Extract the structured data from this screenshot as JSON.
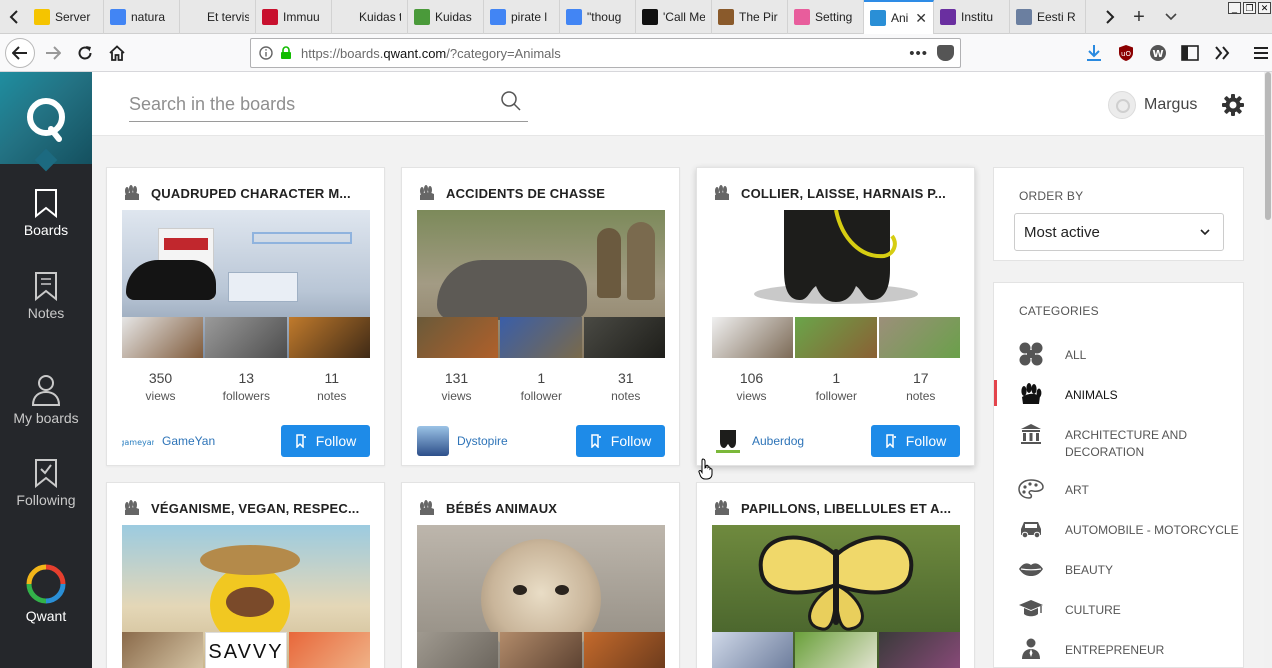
{
  "browser": {
    "tabs": [
      {
        "title": "Server",
        "favicon": "warning-icon",
        "color": "#f5c400"
      },
      {
        "title": "natura",
        "favicon": "google-icon",
        "color": "#4285f4"
      },
      {
        "title": "Et tervist jä",
        "favicon": "none",
        "color": "#e8e8e8"
      },
      {
        "title": "Immuu",
        "favicon": "news-icon",
        "color": "#c8102e"
      },
      {
        "title": "Kuidas tuge",
        "favicon": "none",
        "color": "#e8e8e8"
      },
      {
        "title": "Kuidas",
        "favicon": "leaf-icon",
        "color": "#4a9a3a"
      },
      {
        "title": "pirate l",
        "favicon": "google-icon",
        "color": "#4285f4"
      },
      {
        "title": "\"thoug",
        "favicon": "google-icon",
        "color": "#4285f4"
      },
      {
        "title": "'Call Me",
        "favicon": "in-icon",
        "color": "#111111"
      },
      {
        "title": "The Pir",
        "favicon": "portrait-icon",
        "color": "#8a5a2b"
      },
      {
        "title": "Setting",
        "favicon": "color-wheel-icon",
        "color": "#e85d9c"
      },
      {
        "title": "Ani",
        "favicon": "qwant-icon",
        "color": "#2a8fd6",
        "active": true
      },
      {
        "title": "Institu",
        "favicon": "purple-square-icon",
        "color": "#6a2fa0"
      },
      {
        "title": "Eesti R",
        "favicon": "globe-icon",
        "color": "#6b7fa0"
      }
    ],
    "url_prefix": "https://boards.",
    "url_domain": "qwant.com",
    "url_suffix": "/?category=Animals"
  },
  "sidebar": {
    "items": [
      {
        "label": "Boards",
        "icon": "bookmark-icon"
      },
      {
        "label": "Notes",
        "icon": "note-icon"
      },
      {
        "label": "My boards",
        "icon": "user-icon"
      },
      {
        "label": "Following",
        "icon": "bookmark-check-icon"
      }
    ],
    "qwant_label": "Qwant"
  },
  "header": {
    "search_placeholder": "Search in the boards",
    "user_name": "Margus"
  },
  "cards": [
    {
      "title": "QUADRUPED CHARACTER M...",
      "views": "350",
      "views_label": "views",
      "followers": "13",
      "followers_label": "followers",
      "notes": "11",
      "notes_label": "notes",
      "owner": "GameYan",
      "follow_label": "Follow"
    },
    {
      "title": "ACCIDENTS DE CHASSE",
      "views": "131",
      "views_label": "views",
      "followers": "1",
      "followers_label": "follower",
      "notes": "31",
      "notes_label": "notes",
      "owner": "Dystopire",
      "follow_label": "Follow"
    },
    {
      "title": "COLLIER, LAISSE, HARNAIS P...",
      "views": "106",
      "views_label": "views",
      "followers": "1",
      "followers_label": "follower",
      "notes": "17",
      "notes_label": "notes",
      "owner": "Auberdog",
      "follow_label": "Follow"
    },
    {
      "title": "VÉGANISME, VEGAN, RESPEC...",
      "thumb_text": "SAVVY"
    },
    {
      "title": "BÉBÉS ANIMAUX"
    },
    {
      "title": "PAPILLONS, LIBELLULES ET A..."
    }
  ],
  "order": {
    "heading": "ORDER BY",
    "selected": "Most active"
  },
  "categories": {
    "heading": "CATEGORIES",
    "items": [
      {
        "label": "ALL",
        "icon": "all-icon"
      },
      {
        "label": "ANIMALS",
        "icon": "paw-icon",
        "active": true
      },
      {
        "label": "ARCHITECTURE AND DECORATION",
        "icon": "building-icon"
      },
      {
        "label": "ART",
        "icon": "palette-icon"
      },
      {
        "label": "AUTOMOBILE - MOTORCYCLE",
        "icon": "car-icon"
      },
      {
        "label": "BEAUTY",
        "icon": "lips-icon"
      },
      {
        "label": "CULTURE",
        "icon": "graduation-cap-icon"
      },
      {
        "label": "ENTREPRENEUR",
        "icon": "entrepreneur-icon"
      }
    ]
  }
}
